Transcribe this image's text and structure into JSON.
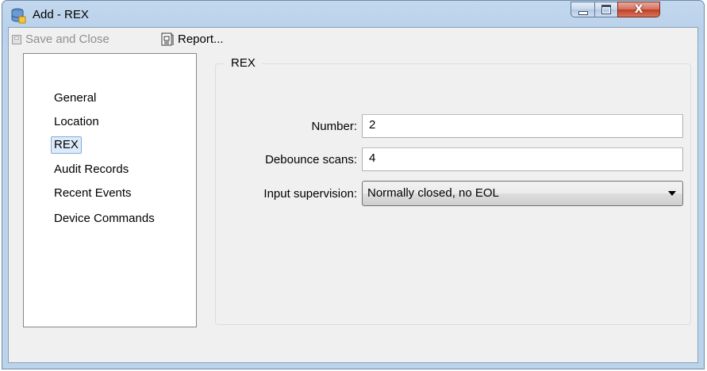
{
  "window": {
    "title": "Add - REX",
    "close_glyph": "X"
  },
  "toolbar": {
    "save_label": "Save and Close",
    "report_label": "Report..."
  },
  "nav": {
    "items": [
      {
        "label": "General",
        "selected": false
      },
      {
        "label": "Location",
        "selected": false
      },
      {
        "label": "REX",
        "selected": true
      },
      {
        "label": "Audit Records",
        "selected": false
      },
      {
        "label": "Recent Events",
        "selected": false
      },
      {
        "label": "Device Commands",
        "selected": false
      }
    ]
  },
  "group": {
    "title": "REX"
  },
  "form": {
    "number_label": "Number:",
    "number_value": "2",
    "debounce_label": "Debounce scans:",
    "debounce_value": "4",
    "supervision_label": "Input supervision:",
    "supervision_value": "Normally closed, no EOL"
  },
  "colors": {
    "accent": "#84acdd",
    "selection_bg": "#dceaf9",
    "close_red": "#c23c24"
  }
}
